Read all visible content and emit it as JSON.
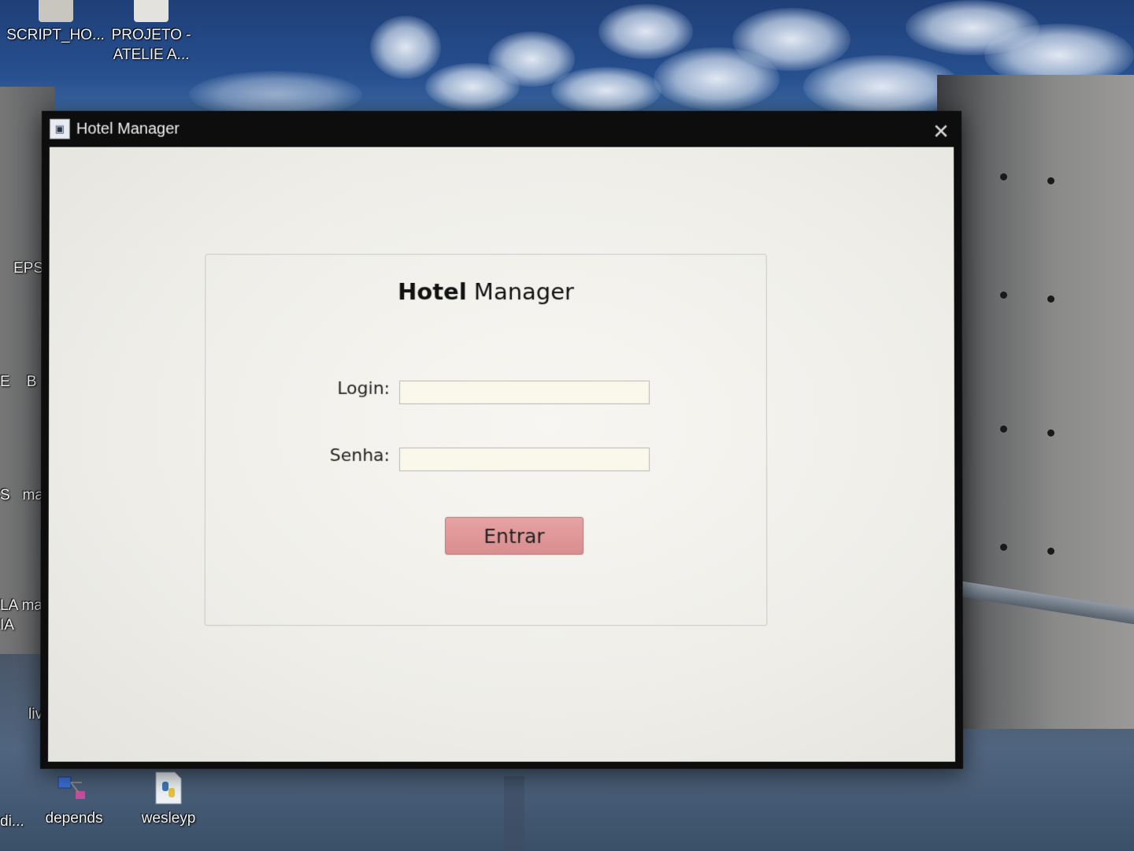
{
  "window": {
    "title": "Hotel Manager"
  },
  "login_form": {
    "title_bold": "Hotel",
    "title_regular": " Manager",
    "login_label": "Login:",
    "login_value": "",
    "senha_label": "Senha:",
    "senha_value": "",
    "submit_label": "Entrar"
  },
  "desktop_icons": [
    {
      "label": "SCRIPT_HO...",
      "icon": "document-icon"
    },
    {
      "label": "PROJETO -\nATELIE A...",
      "icon": "document-icon"
    },
    {
      "label": "EPS",
      "icon": "folder-icon"
    },
    {
      "label": "E    B",
      "icon": "folder-icon"
    },
    {
      "label": "S   mar",
      "icon": "folder-icon"
    },
    {
      "label": "LA mar\nIA",
      "icon": "folder-icon"
    },
    {
      "label": "livr",
      "icon": "folder-icon"
    },
    {
      "label": "di...",
      "icon": "file-icon"
    },
    {
      "label": "depends",
      "icon": "depends-icon"
    },
    {
      "label": "wesleyp",
      "icon": "python-icon"
    }
  ],
  "colors": {
    "button_fill": "#de9494",
    "input_fill": "#faf8ea",
    "window_bg": "#f2f1ec",
    "titlebar": "#0d0d0e"
  }
}
